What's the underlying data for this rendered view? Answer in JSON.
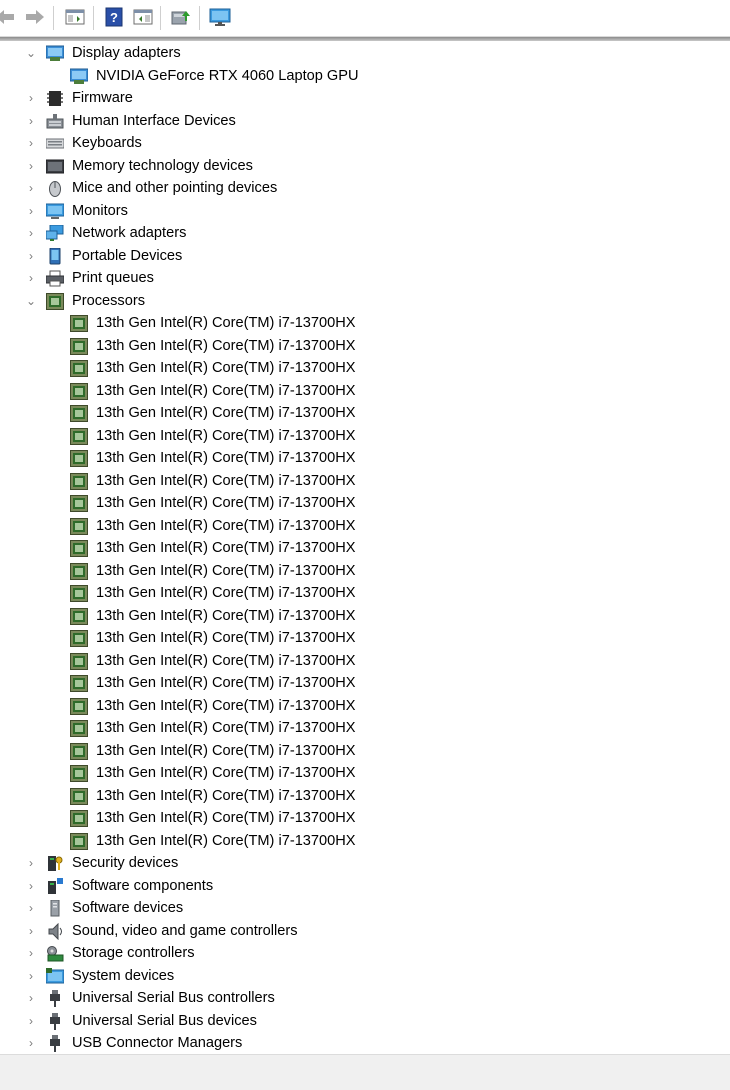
{
  "toolbar": {
    "buttons": [
      {
        "name": "back-button",
        "icon": "back-arrow-icon"
      },
      {
        "name": "forward-button",
        "icon": "forward-arrow-icon"
      },
      {
        "name": "show-hide-console-tree-button",
        "icon": "console-tree-icon"
      },
      {
        "name": "help-button",
        "icon": "help-icon"
      },
      {
        "name": "show-action-pane-button",
        "icon": "action-pane-icon"
      },
      {
        "name": "update-driver-button",
        "icon": "update-driver-icon"
      },
      {
        "name": "scan-hardware-button",
        "icon": "monitor-scan-icon"
      }
    ]
  },
  "tree": {
    "display_adapters": {
      "label": "Display adapters",
      "icon": "display-adapter-icon",
      "expanded": true,
      "children": [
        {
          "label": "NVIDIA GeForce RTX 4060 Laptop GPU",
          "icon": "display-adapter-icon"
        }
      ]
    },
    "firmware": {
      "label": "Firmware",
      "icon": "firmware-icon"
    },
    "hid": {
      "label": "Human Interface Devices",
      "icon": "hid-icon"
    },
    "keyboards": {
      "label": "Keyboards",
      "icon": "keyboard-icon"
    },
    "memory": {
      "label": "Memory technology devices",
      "icon": "memory-icon"
    },
    "mice": {
      "label": "Mice and other pointing devices",
      "icon": "mouse-icon"
    },
    "monitors": {
      "label": "Monitors",
      "icon": "monitor-icon"
    },
    "network": {
      "label": "Network adapters",
      "icon": "network-icon"
    },
    "portable": {
      "label": "Portable Devices",
      "icon": "portable-device-icon"
    },
    "print_queues": {
      "label": "Print queues",
      "icon": "printer-icon"
    },
    "processors": {
      "label": "Processors",
      "icon": "processor-icon",
      "expanded": true,
      "children": [
        {
          "label": "13th Gen Intel(R) Core(TM) i7-13700HX"
        },
        {
          "label": "13th Gen Intel(R) Core(TM) i7-13700HX"
        },
        {
          "label": "13th Gen Intel(R) Core(TM) i7-13700HX"
        },
        {
          "label": "13th Gen Intel(R) Core(TM) i7-13700HX"
        },
        {
          "label": "13th Gen Intel(R) Core(TM) i7-13700HX"
        },
        {
          "label": "13th Gen Intel(R) Core(TM) i7-13700HX"
        },
        {
          "label": "13th Gen Intel(R) Core(TM) i7-13700HX"
        },
        {
          "label": "13th Gen Intel(R) Core(TM) i7-13700HX"
        },
        {
          "label": "13th Gen Intel(R) Core(TM) i7-13700HX"
        },
        {
          "label": "13th Gen Intel(R) Core(TM) i7-13700HX"
        },
        {
          "label": "13th Gen Intel(R) Core(TM) i7-13700HX"
        },
        {
          "label": "13th Gen Intel(R) Core(TM) i7-13700HX"
        },
        {
          "label": "13th Gen Intel(R) Core(TM) i7-13700HX"
        },
        {
          "label": "13th Gen Intel(R) Core(TM) i7-13700HX"
        },
        {
          "label": "13th Gen Intel(R) Core(TM) i7-13700HX"
        },
        {
          "label": "13th Gen Intel(R) Core(TM) i7-13700HX"
        },
        {
          "label": "13th Gen Intel(R) Core(TM) i7-13700HX"
        },
        {
          "label": "13th Gen Intel(R) Core(TM) i7-13700HX"
        },
        {
          "label": "13th Gen Intel(R) Core(TM) i7-13700HX"
        },
        {
          "label": "13th Gen Intel(R) Core(TM) i7-13700HX"
        },
        {
          "label": "13th Gen Intel(R) Core(TM) i7-13700HX"
        },
        {
          "label": "13th Gen Intel(R) Core(TM) i7-13700HX"
        },
        {
          "label": "13th Gen Intel(R) Core(TM) i7-13700HX"
        },
        {
          "label": "13th Gen Intel(R) Core(TM) i7-13700HX"
        }
      ]
    },
    "security": {
      "label": "Security devices",
      "icon": "security-device-icon"
    },
    "software_components": {
      "label": "Software components",
      "icon": "software-component-icon"
    },
    "software_devices": {
      "label": "Software devices",
      "icon": "software-device-icon"
    },
    "sound": {
      "label": "Sound, video and game controllers",
      "icon": "speaker-icon"
    },
    "storage": {
      "label": "Storage controllers",
      "icon": "storage-controller-icon"
    },
    "system": {
      "label": "System devices",
      "icon": "system-device-icon"
    },
    "usb_controllers": {
      "label": "Universal Serial Bus controllers",
      "icon": "usb-icon"
    },
    "usb_devices": {
      "label": "Universal Serial Bus devices",
      "icon": "usb-icon"
    },
    "usb_connectors": {
      "label": "USB Connector Managers",
      "icon": "usb-icon"
    }
  },
  "colors": {
    "chevron": "#7a7a7a",
    "processor_chip": "#2f6b2a",
    "toolbar_separator": "#cfcfcf",
    "statusbar_bg": "#f0f0f0"
  }
}
